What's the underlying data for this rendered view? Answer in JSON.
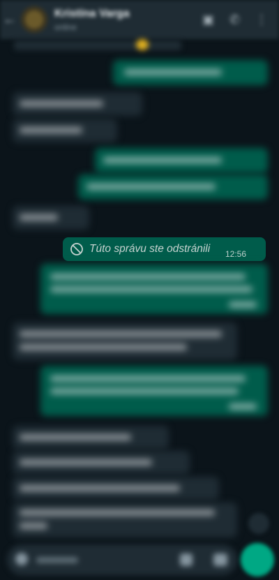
{
  "header": {
    "contact_name": "Kristína Varga",
    "status": "online",
    "back_icon": "arrow-left-icon",
    "icons": [
      "video-call-icon",
      "phone-icon",
      "more-vert-icon"
    ]
  },
  "deleted_message": {
    "text": "Túto správu ste odstránili",
    "time": "12:56",
    "icon": "block-icon"
  },
  "composer": {
    "placeholder": "Správa",
    "mic_icon": "mic-icon"
  },
  "colors": {
    "background": "#0b141a",
    "outgoing_bubble": "#005c4b",
    "incoming_bubble": "#1f2c34",
    "accent": "#00a884"
  }
}
